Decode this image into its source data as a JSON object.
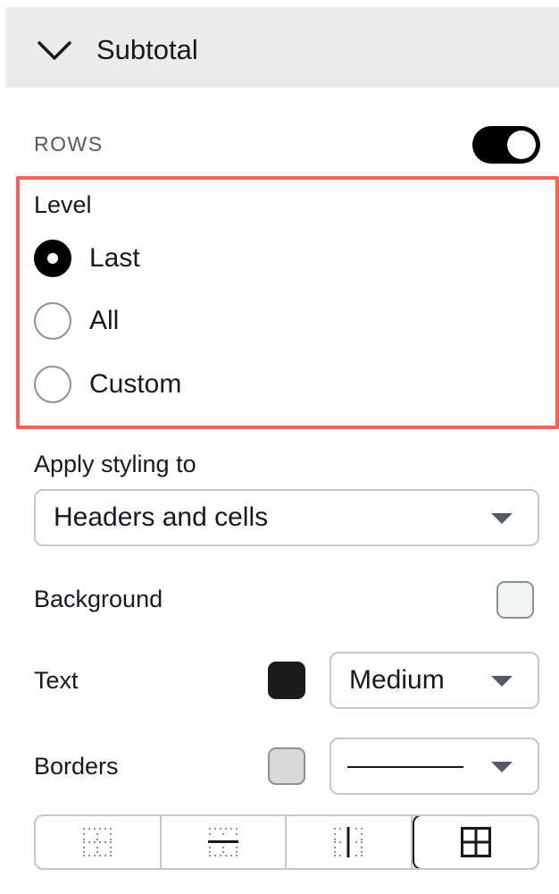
{
  "header": {
    "title": "Subtotal"
  },
  "rows": {
    "label": "ROWS",
    "toggle_on": true
  },
  "level": {
    "title": "Level",
    "options": [
      {
        "label": "Last",
        "checked": true
      },
      {
        "label": "All",
        "checked": false
      },
      {
        "label": "Custom",
        "checked": false
      }
    ]
  },
  "apply_styling": {
    "label": "Apply styling to",
    "selected": "Headers and cells"
  },
  "background": {
    "label": "Background",
    "color": "#f2f3f3"
  },
  "text": {
    "label": "Text",
    "color": "#1b1b1b",
    "weight_selected": "Medium"
  },
  "borders": {
    "label": "Borders",
    "color": "#d9d9d9",
    "style_selected": "solid",
    "options": [
      {
        "name": "border-none-icon",
        "active": false
      },
      {
        "name": "border-horizontal-icon",
        "active": false
      },
      {
        "name": "border-vertical-icon",
        "active": false
      },
      {
        "name": "border-all-icon",
        "active": true
      }
    ]
  },
  "colors": {
    "highlight": "#f0645a",
    "toggle": "#000000"
  }
}
